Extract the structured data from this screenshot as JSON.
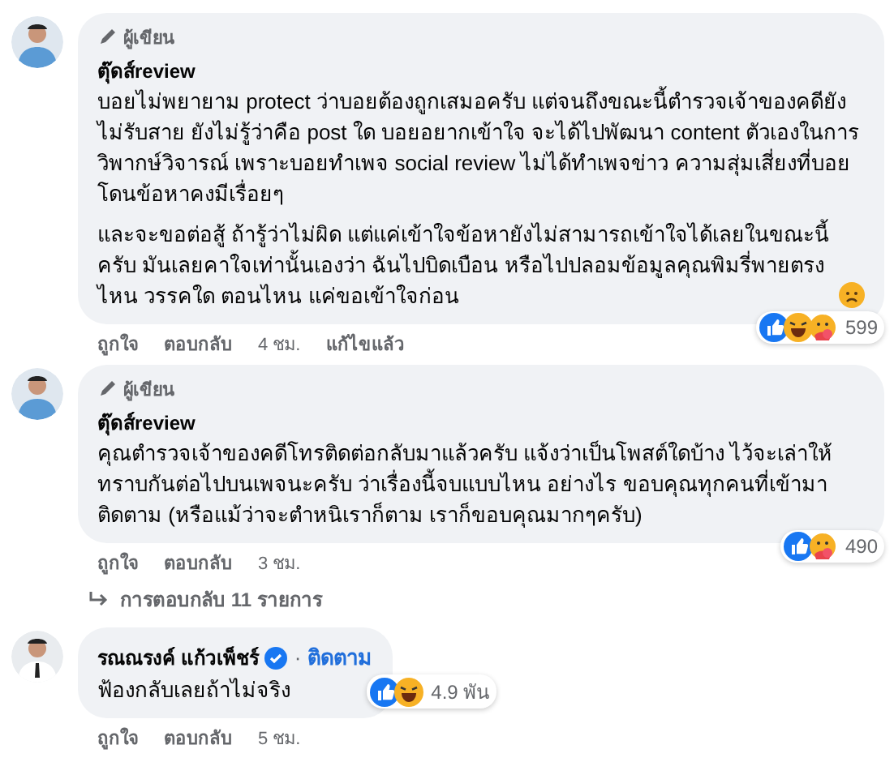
{
  "comments": [
    {
      "author_badge": "ผู้เขียน",
      "name": "ตุ๊ดส์review",
      "verified": false,
      "paragraphs": [
        "บอยไม่พยายาม protect ว่าบอยต้องถูกเสมอครับ แต่จนถึงขณะนี้ตำรวจเจ้าของคดียังไม่รับสาย ยังไม่รู้ว่าคือ post ใด บอยอยากเข้าใจ จะได้ไปพัฒนา content ตัวเองในการวิพากษ์วิจารณ์ เพราะบอยทำเพจ social review ไม่ได้ทำเพจข่าว ความสุ่มเสี่ยงที่บอยโดนข้อหาคงมีเรื่อยๆ",
        "และจะขอต่อสู้ ถ้ารู้ว่าไม่ผิด แต่แค่เข้าใจข้อหายังไม่สามารถเข้าใจได้เลยในขณะนี้ครับ มันเลยคาใจเท่านั้นเองว่า ฉันไปบิดเบือน หรือไปปลอมข้อมูลคุณพิมรี่พายตรงไหน วรรคใด ตอนไหน แค่ขอเข้าใจก่อน"
      ],
      "emoji": {
        "kind": "sad"
      },
      "reactions": [
        {
          "kind": "like"
        },
        {
          "kind": "haha"
        },
        {
          "kind": "care"
        }
      ],
      "reaction_count": "599",
      "actions": [
        "ถูกใจ",
        "ตอบกลับ",
        "4 ชม.",
        "แก้ไขแล้ว"
      ]
    },
    {
      "author_badge": "ผู้เขียน",
      "name": "ตุ๊ดส์review",
      "verified": false,
      "paragraphs": [
        "คุณตำรวจเจ้าของคดีโทรติดต่อกลับมาแล้วครับ แจ้งว่าเป็นโพสต์ใดบ้าง ไว้จะเล่าให้ทราบกันต่อไปบนเพจนะครับ ว่าเรื่องนี้จบแบบไหน อย่างไร ขอบคุณทุกคนที่เข้ามาติดตาม (หรือแม้ว่าจะตำหนิเราก็ตาม เราก็ขอบคุณมากๆครับ)"
      ],
      "reactions": [
        {
          "kind": "like"
        },
        {
          "kind": "care"
        }
      ],
      "reaction_count": "490",
      "actions": [
        "ถูกใจ",
        "ตอบกลับ",
        "3 ชม."
      ],
      "more_replies": "การตอบกลับ 11 รายการ"
    },
    {
      "name": "รณณรงค์ แก้วเพ็ชร์",
      "verified": true,
      "separator": "·",
      "follow": "ติดตาม",
      "paragraphs": [
        "ฟ้องกลับเลยถ้าไม่จริง"
      ],
      "reactions": [
        {
          "kind": "like"
        },
        {
          "kind": "haha"
        }
      ],
      "reaction_count": "4.9 พัน",
      "actions": [
        "ถูกใจ",
        "ตอบกลับ",
        "5 ชม."
      ]
    }
  ]
}
